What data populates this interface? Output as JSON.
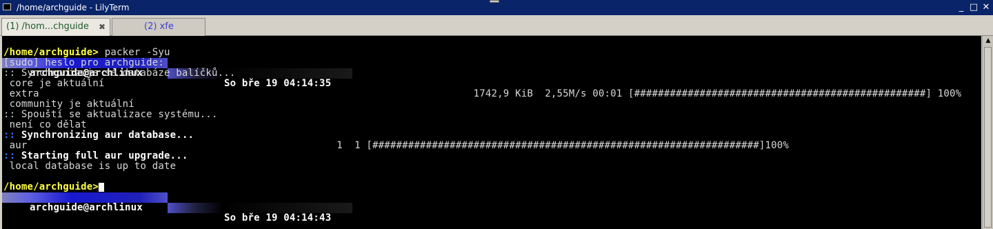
{
  "window": {
    "title": "/home/archguide - LilyTerm",
    "minimize_glyph": "_",
    "maximize_glyph": "□",
    "close_glyph": "✕"
  },
  "tabs": [
    {
      "label": "(1) /hom...chguide",
      "close_glyph": "✖"
    },
    {
      "label": "(2) xfe"
    }
  ],
  "terminal": {
    "status1": {
      "user": "archguide@archlinux",
      "datetime": "So bře 19 04:14:35"
    },
    "prompt1": {
      "path": "/home/archguide>",
      "command": " packer -Syu"
    },
    "lines": [
      "[sudo] heslo pro archguide:",
      ":: Synchronizuje se databáze balíčků...",
      " core je aktuální",
      " extra                                                                         1742,9 KiB  2,55M/s 00:01 [#################################################] 100%",
      " community je aktuální",
      ":: Spouští se aktualizace systému...",
      " není co dělat"
    ],
    "aur_sync": {
      "prefix": ":: ",
      "text": "Synchronizing aur database..."
    },
    "aur_line": " aur                                                    1  1 [#################################################################]100%",
    "aur_upgrade": {
      "prefix": ":: ",
      "text": "Starting full aur upgrade..."
    },
    "local_line": " local database is up to date",
    "status2": {
      "user": "archguide@archlinux",
      "datetime": "So bře 19 04:14:43"
    },
    "prompt2": {
      "path": "/home/archguide>"
    }
  }
}
